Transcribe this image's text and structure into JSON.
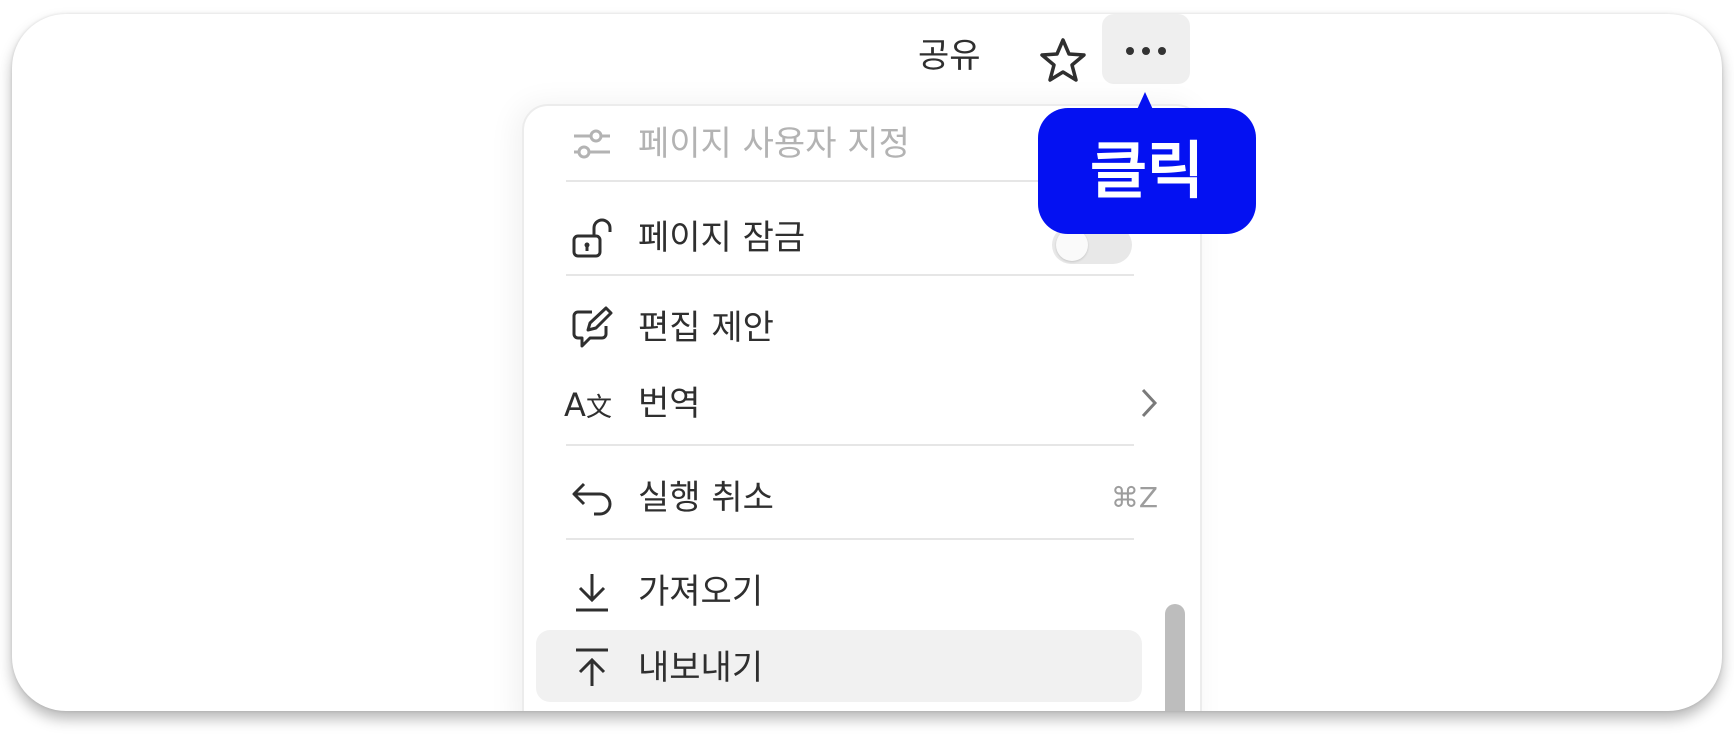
{
  "topbar": {
    "share_label": "공유",
    "favorite_icon": "star-icon",
    "more_icon": "ellipsis-icon"
  },
  "menu": {
    "items": [
      {
        "icon": "sliders-icon",
        "label": "페이지 사용자 지정",
        "disabled": true
      },
      {
        "icon": "unlock-icon",
        "label": "페이지 잠금",
        "toggle": false
      },
      {
        "icon": "suggest-edit-icon",
        "label": "편집 제안"
      },
      {
        "icon": "translate-icon",
        "label": "번역",
        "submenu": true
      },
      {
        "icon": "undo-icon",
        "label": "실행 취소",
        "shortcut": "⌘Z"
      },
      {
        "icon": "download-icon",
        "label": "가져오기"
      },
      {
        "icon": "upload-icon",
        "label": "내보내기",
        "highlighted": true
      }
    ]
  },
  "callout": {
    "text": "클릭",
    "color": "#0411f2"
  }
}
